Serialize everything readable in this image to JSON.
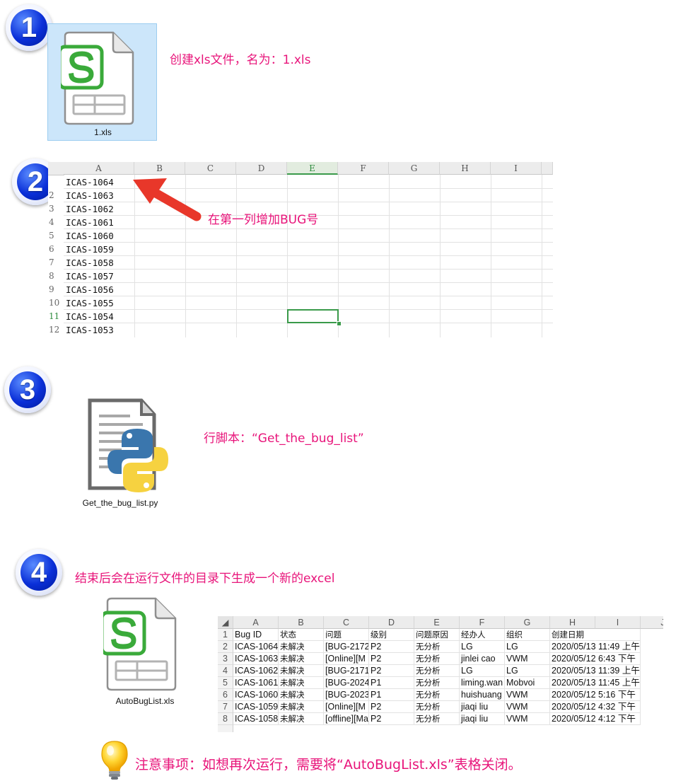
{
  "steps": {
    "s1": {
      "badge": "1",
      "file_label": "1.xls",
      "text": "创建xls文件，名为：1.xls"
    },
    "s2": {
      "badge": "2",
      "callout": "在第一列增加BUG号"
    },
    "s3": {
      "badge": "3",
      "file_label": "Get_the_bug_list.py",
      "text": "行脚本：“Get_the_bug_list”"
    },
    "s4": {
      "badge": "4",
      "file_label": "AutoBugList.xls",
      "text": "结束后会在运行文件的目录下生成一个新的excel"
    }
  },
  "sheet1": {
    "columns": [
      "A",
      "B",
      "C",
      "D",
      "E",
      "F",
      "G",
      "H",
      "I"
    ],
    "selected_column": "E",
    "selected_row": "11",
    "rows": [
      {
        "num": "",
        "a": "ICAS-1064"
      },
      {
        "num": "2",
        "a": "ICAS-1063"
      },
      {
        "num": "3",
        "a": "ICAS-1062"
      },
      {
        "num": "4",
        "a": "ICAS-1061"
      },
      {
        "num": "5",
        "a": "ICAS-1060"
      },
      {
        "num": "6",
        "a": "ICAS-1059"
      },
      {
        "num": "7",
        "a": "ICAS-1058"
      },
      {
        "num": "8",
        "a": "ICAS-1057"
      },
      {
        "num": "9",
        "a": "ICAS-1056"
      },
      {
        "num": "10",
        "a": "ICAS-1055"
      },
      {
        "num": "11",
        "a": "ICAS-1054"
      },
      {
        "num": "12",
        "a": "ICAS-1053"
      }
    ]
  },
  "sheet2": {
    "columns": [
      "A",
      "B",
      "C",
      "D",
      "E",
      "F",
      "G",
      "H",
      "I",
      "J"
    ],
    "rows": [
      {
        "num": "1",
        "cells": [
          "Bug ID",
          "状态",
          "问题",
          "级别",
          "问题原因",
          "经办人",
          "组织",
          "创建日期",
          ""
        ]
      },
      {
        "num": "2",
        "cells": [
          "ICAS-1064",
          "未解决",
          "[BUG-2172",
          "P2",
          "无分析",
          "LG",
          "LG",
          "2020/05/13 11:49 上午",
          ""
        ]
      },
      {
        "num": "3",
        "cells": [
          "ICAS-1063",
          "未解决",
          "[Online][M",
          "P2",
          "无分析",
          "jinlei cao",
          "VWM",
          "2020/05/12 6:43 下午",
          ""
        ]
      },
      {
        "num": "4",
        "cells": [
          "ICAS-1062",
          "未解决",
          "[BUG-2171",
          "P2",
          "无分析",
          "LG",
          "LG",
          "2020/05/13 11:39 上午",
          ""
        ]
      },
      {
        "num": "5",
        "cells": [
          "ICAS-1061",
          "未解决",
          "[BUG-2024",
          "P1",
          "无分析",
          "liming.wan",
          "Mobvoi",
          "2020/05/13 11:45 上午",
          ""
        ]
      },
      {
        "num": "6",
        "cells": [
          "ICAS-1060",
          "未解决",
          "[BUG-2023",
          "P1",
          "无分析",
          "huishuang",
          "VWM",
          "2020/05/12 5:16 下午",
          ""
        ]
      },
      {
        "num": "7",
        "cells": [
          "ICAS-1059",
          "未解决",
          "[Online][M",
          "P2",
          "无分析",
          "jiaqi liu",
          "VWM",
          "2020/05/12 4:32 下午",
          ""
        ]
      },
      {
        "num": "8",
        "cells": [
          "ICAS-1058",
          "未解决",
          "[offline][Ma",
          "P2",
          "无分析",
          "jiaqi liu",
          "VWM",
          "2020/05/12 4:12 下午",
          ""
        ]
      }
    ]
  },
  "note": {
    "text": "注意事项：如想再次运行，需要将“AutoBugList.xls”表格关闭。",
    "icon": "lightbulb-icon"
  },
  "colors": {
    "accent_pink": "#e8147a",
    "badge_blue": "#0a2fd8",
    "wps_green": "#3aaa3a",
    "python_blue": "#3a76ad",
    "python_yellow": "#f6d240",
    "selection_green": "#3a9a4a",
    "file_select_bg": "#cce6fa"
  }
}
